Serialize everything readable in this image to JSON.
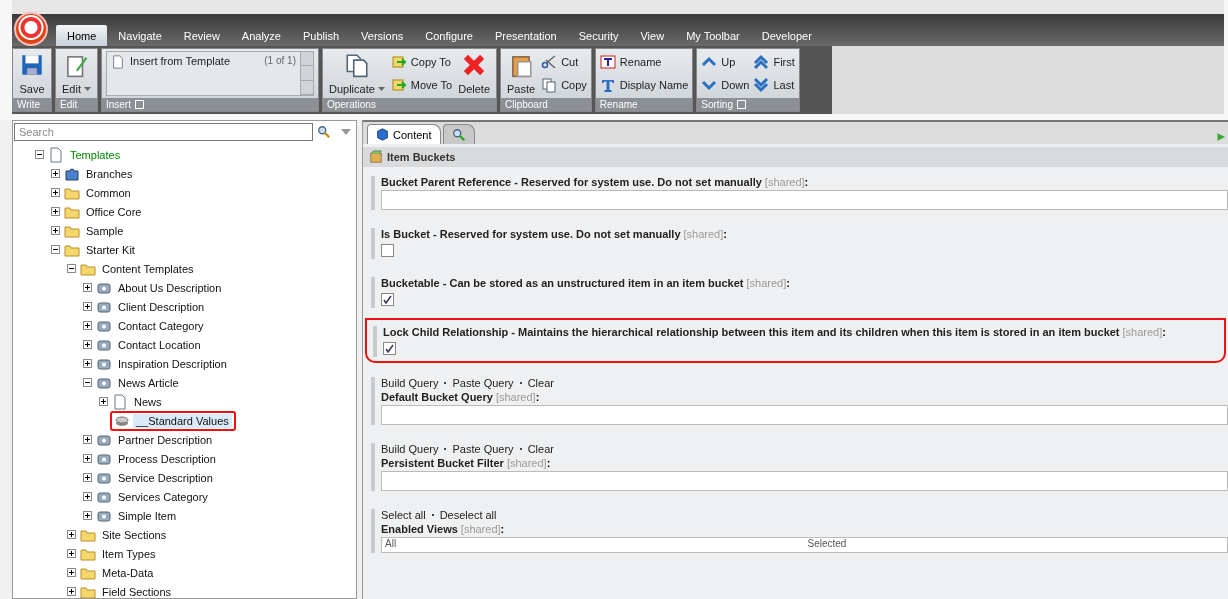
{
  "tabs": [
    {
      "label": "Home",
      "selected": true
    },
    {
      "label": "Navigate",
      "selected": false
    },
    {
      "label": "Review",
      "selected": false
    },
    {
      "label": "Analyze",
      "selected": false
    },
    {
      "label": "Publish",
      "selected": false
    },
    {
      "label": "Versions",
      "selected": false
    },
    {
      "label": "Configure",
      "selected": false
    },
    {
      "label": "Presentation",
      "selected": false
    },
    {
      "label": "Security",
      "selected": false
    },
    {
      "label": "View",
      "selected": false
    },
    {
      "label": "My Toolbar",
      "selected": false
    },
    {
      "label": "Developer",
      "selected": false
    }
  ],
  "ribbon_groups": [
    {
      "label": "Write",
      "launcher": false,
      "buttons": [
        {
          "label": "Save",
          "kind": "large",
          "dropdown": false
        }
      ]
    },
    {
      "label": "Edit",
      "launcher": false,
      "buttons": [
        {
          "label": "Edit",
          "kind": "large",
          "dropdown": true
        }
      ]
    },
    {
      "label": "Insert",
      "launcher": true,
      "gallery": {
        "item": "Insert from Template",
        "count": "(1 of 1)"
      }
    },
    {
      "label": "Operations",
      "launcher": false,
      "buttons": [
        {
          "label": "Duplicate",
          "kind": "large",
          "dropdown": true
        },
        {
          "label": "Copy To",
          "kind": "small",
          "dropdown": false
        },
        {
          "label": "Move To",
          "kind": "small",
          "dropdown": false
        },
        {
          "label": "Delete",
          "kind": "large",
          "dropdown": false
        }
      ]
    },
    {
      "label": "Clipboard",
      "launcher": false,
      "buttons": [
        {
          "label": "Paste",
          "kind": "large",
          "dropdown": false
        },
        {
          "label": "Cut",
          "kind": "small",
          "dropdown": false
        },
        {
          "label": "Copy",
          "kind": "small",
          "dropdown": false
        }
      ]
    },
    {
      "label": "Rename",
      "launcher": false,
      "buttons": [
        {
          "label": "Rename",
          "kind": "small",
          "dropdown": false
        },
        {
          "label": "Display Name",
          "kind": "small",
          "dropdown": false
        }
      ]
    },
    {
      "label": "Sorting",
      "launcher": true,
      "buttons": [
        {
          "label": "Up",
          "kind": "small",
          "dropdown": false
        },
        {
          "label": "Down",
          "kind": "small",
          "dropdown": false
        },
        {
          "label": "First",
          "kind": "small",
          "dropdown": false
        },
        {
          "label": "Last",
          "kind": "small",
          "dropdown": false
        }
      ]
    }
  ],
  "search": {
    "placeholder": "Search"
  },
  "tree": [
    {
      "label": "Templates",
      "kind": "root",
      "expanded": true,
      "selected": false,
      "highlighted": false,
      "children": [
        {
          "label": "Branches",
          "kind": "branch",
          "expanded": false,
          "selected": false,
          "highlighted": false
        },
        {
          "label": "Common",
          "kind": "folder",
          "expanded": false,
          "selected": false,
          "highlighted": false
        },
        {
          "label": "Office Core",
          "kind": "folder",
          "expanded": false,
          "selected": false,
          "highlighted": false
        },
        {
          "label": "Sample",
          "kind": "folder",
          "expanded": false,
          "selected": false,
          "highlighted": false
        },
        {
          "label": "Starter Kit",
          "kind": "folder",
          "expanded": true,
          "selected": false,
          "highlighted": false,
          "children": [
            {
              "label": "Content Templates",
              "kind": "folder",
              "expanded": true,
              "selected": false,
              "highlighted": false,
              "children": [
                {
                  "label": "About Us Description",
                  "kind": "template",
                  "expanded": false,
                  "selected": false,
                  "highlighted": false
                },
                {
                  "label": "Client Description",
                  "kind": "template",
                  "expanded": false,
                  "selected": false,
                  "highlighted": false
                },
                {
                  "label": "Contact Category",
                  "kind": "template",
                  "expanded": false,
                  "selected": false,
                  "highlighted": false
                },
                {
                  "label": "Contact Location",
                  "kind": "template",
                  "expanded": false,
                  "selected": false,
                  "highlighted": false
                },
                {
                  "label": "Inspiration Description",
                  "kind": "template",
                  "expanded": false,
                  "selected": false,
                  "highlighted": false
                },
                {
                  "label": "News Article",
                  "kind": "template",
                  "expanded": true,
                  "selected": false,
                  "highlighted": false,
                  "children": [
                    {
                      "label": "News",
                      "kind": "page",
                      "expanded": false,
                      "selected": false,
                      "highlighted": false
                    },
                    {
                      "label": "__Standard Values",
                      "kind": "leaf",
                      "expanded": false,
                      "selected": true,
                      "highlighted": true
                    }
                  ]
                },
                {
                  "label": "Partner Description",
                  "kind": "template",
                  "expanded": false,
                  "selected": false,
                  "highlighted": false
                },
                {
                  "label": "Process Description",
                  "kind": "template",
                  "expanded": false,
                  "selected": false,
                  "highlighted": false
                },
                {
                  "label": "Service Description",
                  "kind": "template",
                  "expanded": false,
                  "selected": false,
                  "highlighted": false
                },
                {
                  "label": "Services Category",
                  "kind": "template",
                  "expanded": false,
                  "selected": false,
                  "highlighted": false
                },
                {
                  "label": "Simple Item",
                  "kind": "template",
                  "expanded": false,
                  "selected": false,
                  "highlighted": false
                }
              ]
            },
            {
              "label": "Site Sections",
              "kind": "folder",
              "expanded": false,
              "selected": false,
              "highlighted": false
            },
            {
              "label": "Item Types",
              "kind": "folder",
              "expanded": false,
              "selected": false,
              "highlighted": false
            },
            {
              "label": "Meta-Data",
              "kind": "folder",
              "expanded": false,
              "selected": false,
              "highlighted": false
            },
            {
              "label": "Field Sections",
              "kind": "folder",
              "expanded": false,
              "selected": false,
              "highlighted": false
            }
          ]
        }
      ]
    }
  ],
  "editor_tabs": [
    {
      "label": "Content",
      "selected": true
    },
    {
      "selected": false
    }
  ],
  "section": {
    "title": "Item Buckets"
  },
  "fields": [
    {
      "kind": "text",
      "label": "Bucket Parent Reference - Reserved for system use. Do not set manually",
      "shared": "[shared]",
      "colon": ":",
      "highlighted": false
    },
    {
      "kind": "checkbox",
      "label": "Is Bucket - Reserved for system use. Do not set manually",
      "shared": "[shared]",
      "colon": ":",
      "checked": false,
      "highlighted": false
    },
    {
      "kind": "checkbox",
      "label": "Bucketable - Can be stored as an unstructured item in an item bucket",
      "shared": "[shared]",
      "colon": ":",
      "checked": true,
      "highlighted": false
    },
    {
      "kind": "checkbox",
      "label": "Lock Child Relationship - Maintains the hierarchical relationship between this item and its children when this item is stored in an item bucket",
      "shared": "[shared]",
      "colon": ":",
      "checked": true,
      "highlighted": true
    },
    {
      "kind": "text",
      "links": [
        "Build Query",
        "Paste Query",
        "Clear"
      ],
      "label": "Default Bucket Query",
      "shared": "[shared]",
      "colon": ":",
      "highlighted": false
    },
    {
      "kind": "text",
      "links": [
        "Build Query",
        "Paste Query",
        "Clear"
      ],
      "label": "Persistent Bucket Filter",
      "shared": "[shared]",
      "colon": ":",
      "highlighted": false
    },
    {
      "kind": "multilist",
      "links": [
        "Select all",
        "Deselect all"
      ],
      "label": "Enabled Views",
      "shared": "[shared]",
      "colon": ":",
      "columns": [
        "All",
        "Selected"
      ],
      "highlighted": false
    }
  ]
}
